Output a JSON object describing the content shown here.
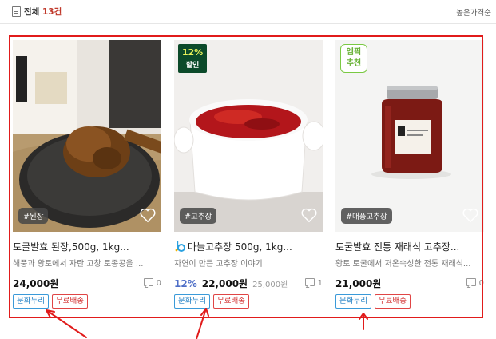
{
  "header": {
    "total_prefix": "전체",
    "total_count": "13건",
    "sort_label": "높은가격순"
  },
  "products": [
    {
      "tag": "#된장",
      "title": "토굴발효 된장,500g, 1kg...",
      "description": "해풍과 황토에서 자란 고창 토종콩을 ...",
      "price": "24,000원",
      "comments": "0",
      "btn_culture": "문화누리",
      "btn_shipping": "무료배송"
    },
    {
      "badge_pct": "12%",
      "badge_label": "할인",
      "tag": "#고추장",
      "title": "마늘고추장 500g, 1kg...",
      "description": "자연이 만든 고추장 이야기",
      "discount": "12%",
      "price": "22,000원",
      "original_price": "25,000원",
      "comments": "1",
      "btn_culture": "문화누리",
      "btn_shipping": "무료배송"
    },
    {
      "badge_pick_line1": "엠픽",
      "badge_pick_line2": "추천",
      "tag": "#매풍고추장",
      "title": "토굴발효 전통 재래식 고추장...",
      "description": "황토 토굴에서 저온숙성한 전통 재래식...",
      "price": "21,000원",
      "comments": "0",
      "btn_culture": "문화누리",
      "btn_shipping": "무료배송"
    }
  ],
  "colors": {
    "highlight_border": "#e11b1b",
    "culture_button": "#1f7fc4",
    "shipping_button": "#d12b2b",
    "discount": "#4e6ec7"
  }
}
